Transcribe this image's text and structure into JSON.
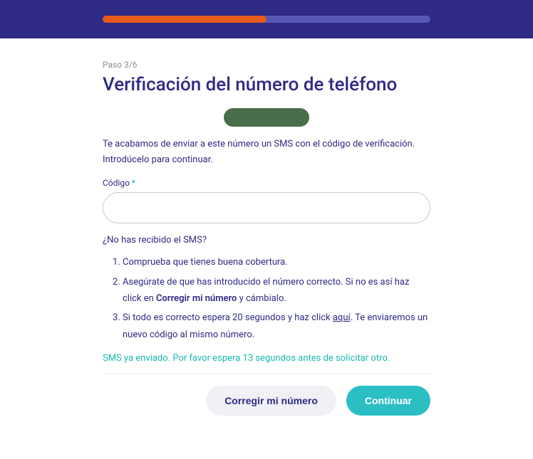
{
  "progress": {
    "percent": 50
  },
  "step_label": "Paso 3/6",
  "title": "Verificación del número de teléfono",
  "instructions": "Te acabamos de enviar a este número un SMS con el código de verificación. Introdúcelo para continuar.",
  "code_field": {
    "label": "Código",
    "required_mark": "*"
  },
  "help": {
    "title": "¿No has recibido el SMS?",
    "item1": "Comprueba que tienes buena cobertura.",
    "item2_pre": "Asegúrate de que has introducido el número correcto. Si no es así haz click en ",
    "item2_bold": "Corregir mi número",
    "item2_post": " y cámbialo.",
    "item3_pre": "Si todo es correcto espera 20 segundos y haz click ",
    "item3_link": "aquí",
    "item3_post": ". Te enviaremos un nuevo código al mismo número."
  },
  "status": "SMS ya enviado. Por favor espera 13 segundos antes de solicitar otro.",
  "buttons": {
    "secondary": "Corregir mi número",
    "primary": "Continuar"
  }
}
